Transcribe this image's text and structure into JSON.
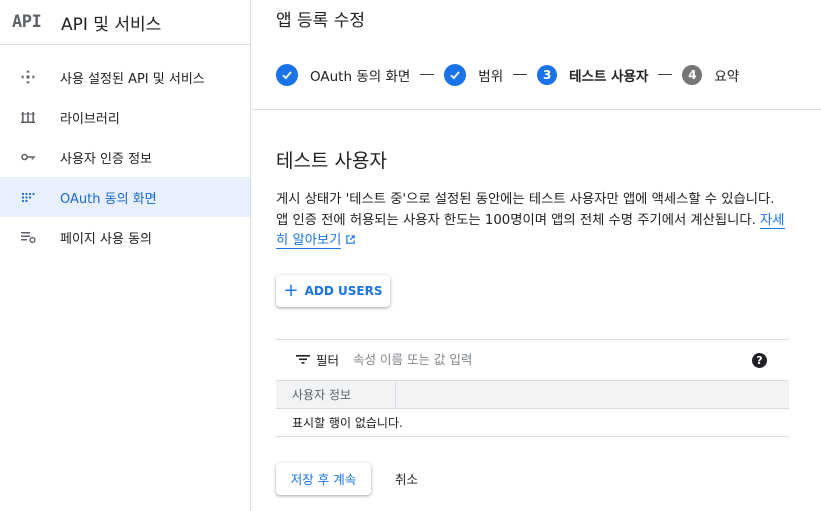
{
  "sidebar": {
    "logo": "API",
    "title": "API 및 서비스",
    "items": [
      {
        "label": "사용 설정된 API 및 서비스",
        "icon": "enabled-apis-icon"
      },
      {
        "label": "라이브러리",
        "icon": "library-icon"
      },
      {
        "label": "사용자 인증 정보",
        "icon": "key-icon"
      },
      {
        "label": "OAuth 동의 화면",
        "icon": "oauth-consent-icon",
        "active": true
      },
      {
        "label": "페이지 사용 동의",
        "icon": "page-usage-agreement-icon"
      }
    ]
  },
  "main": {
    "title": "앱 등록 수정",
    "steps": [
      {
        "label": "OAuth 동의 화면",
        "state": "done"
      },
      {
        "label": "범위",
        "state": "done"
      },
      {
        "number": "3",
        "label": "테스트 사용자",
        "state": "current"
      },
      {
        "number": "4",
        "label": "요약",
        "state": "pending"
      }
    ],
    "section_title": "테스트 사용자",
    "description": "게시 상태가 '테스트 중'으로 설정된 동안에는 테스트 사용자만 앱에 액세스할 수 있습니다. 앱 인증 전에 허용되는 사용자 한도는 100명이며 앱의 전체 수명 주기에서 계산됩니다.",
    "learn_more": "자세히 알아보기",
    "add_users_label": "ADD USERS",
    "filter": {
      "label": "필터",
      "placeholder": "속성 이름 또는 값 입력"
    },
    "help_glyph": "?",
    "table": {
      "columns": [
        "사용자 정보"
      ],
      "empty_text": "표시할 행이 없습니다."
    },
    "save_label": "저장 후 계속",
    "cancel_label": "취소"
  },
  "colors": {
    "accent": "#1a73e8",
    "active_bg": "#e8f0fe",
    "active_text": "#1967d2",
    "pending_step": "#757575"
  }
}
